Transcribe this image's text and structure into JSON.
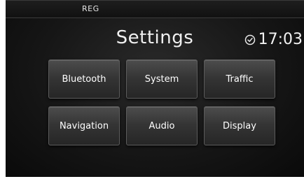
{
  "status_bar": {
    "label": "REG"
  },
  "header": {
    "title": "Settings",
    "time": "17:03"
  },
  "menu": {
    "items": [
      {
        "label": "Bluetooth"
      },
      {
        "label": "System"
      },
      {
        "label": "Traffic"
      },
      {
        "label": "Navigation"
      },
      {
        "label": "Audio"
      },
      {
        "label": "Display"
      }
    ]
  },
  "icons": {
    "clock": "clock-icon"
  },
  "colors": {
    "background": "#161616",
    "text": "#ffffff",
    "button": "#353535"
  }
}
